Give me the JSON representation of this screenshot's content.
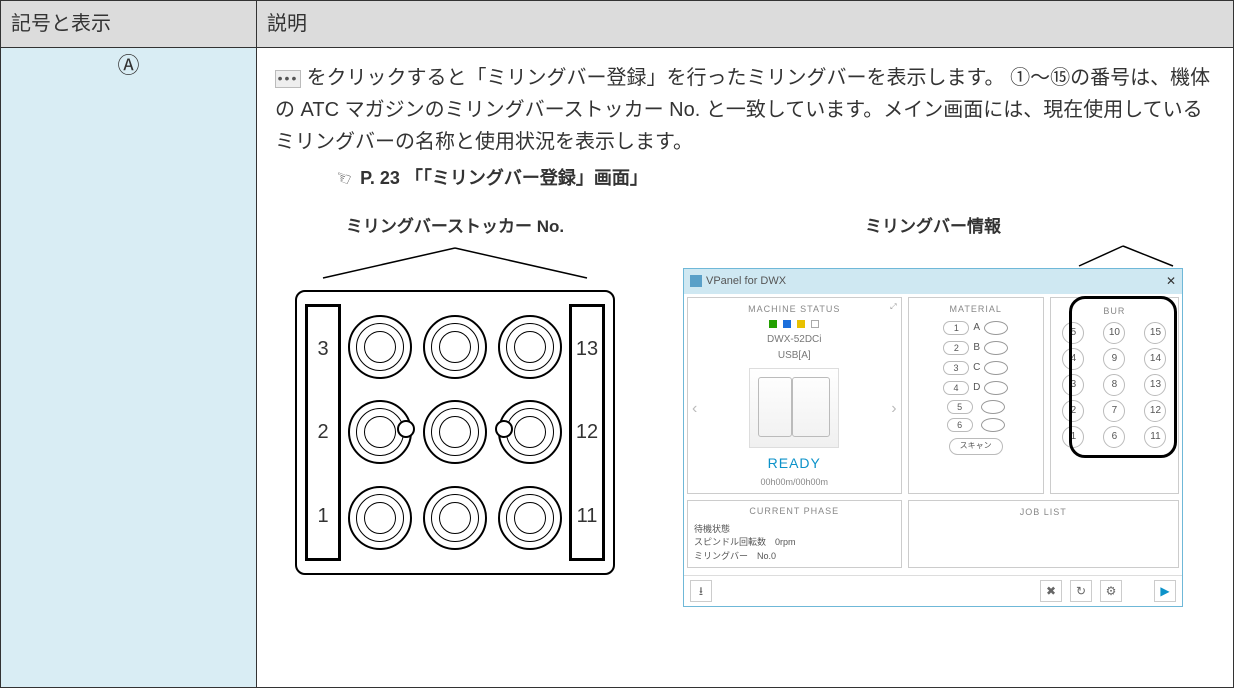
{
  "headers": {
    "left": "記号と表示",
    "right": "説明"
  },
  "row": {
    "symbol": "Ⓐ"
  },
  "desc": {
    "p1a": "をクリックすると「ミリングバー登録」を行ったミリングバーを表示します。",
    "p2": "①〜⑮の番号は、機体の ATC マガジンのミリングバーストッカー No. と一致しています。メイン画面には、現在使用しているミリングバーの名称と使用状況を表示します。",
    "ref": "P. 23 「「ミリングバー登録」画面」"
  },
  "fig": {
    "stocker_label": "ミリングバーストッカー No.",
    "bur_label": "ミリングバー情報",
    "left_numbers": [
      "3",
      "2",
      "1"
    ],
    "right_numbers": [
      "13",
      "12",
      "11"
    ]
  },
  "vp": {
    "title": "VPanel for DWX",
    "machine_status": "MACHINE STATUS",
    "material": "MATERIAL",
    "bur": "BUR",
    "current_phase": "CURRENT PHASE",
    "job_list": "JOB LIST",
    "model": "DWX-52DCi",
    "conn": "USB[A]",
    "ready": "READY",
    "time": "00h00m/00h00m",
    "scan": "スキャン",
    "materials": [
      "A",
      "B",
      "C",
      "D",
      "",
      ""
    ],
    "material_slots": [
      "1",
      "2",
      "3",
      "4",
      "5",
      "6"
    ],
    "bur_numbers": [
      5,
      10,
      15,
      4,
      9,
      14,
      3,
      8,
      13,
      2,
      7,
      12,
      1,
      6,
      11
    ],
    "phase": {
      "l1": "待機状態",
      "l2": "スピンドル回転数　0rpm",
      "l3": "ミリングバー　No.0"
    }
  }
}
